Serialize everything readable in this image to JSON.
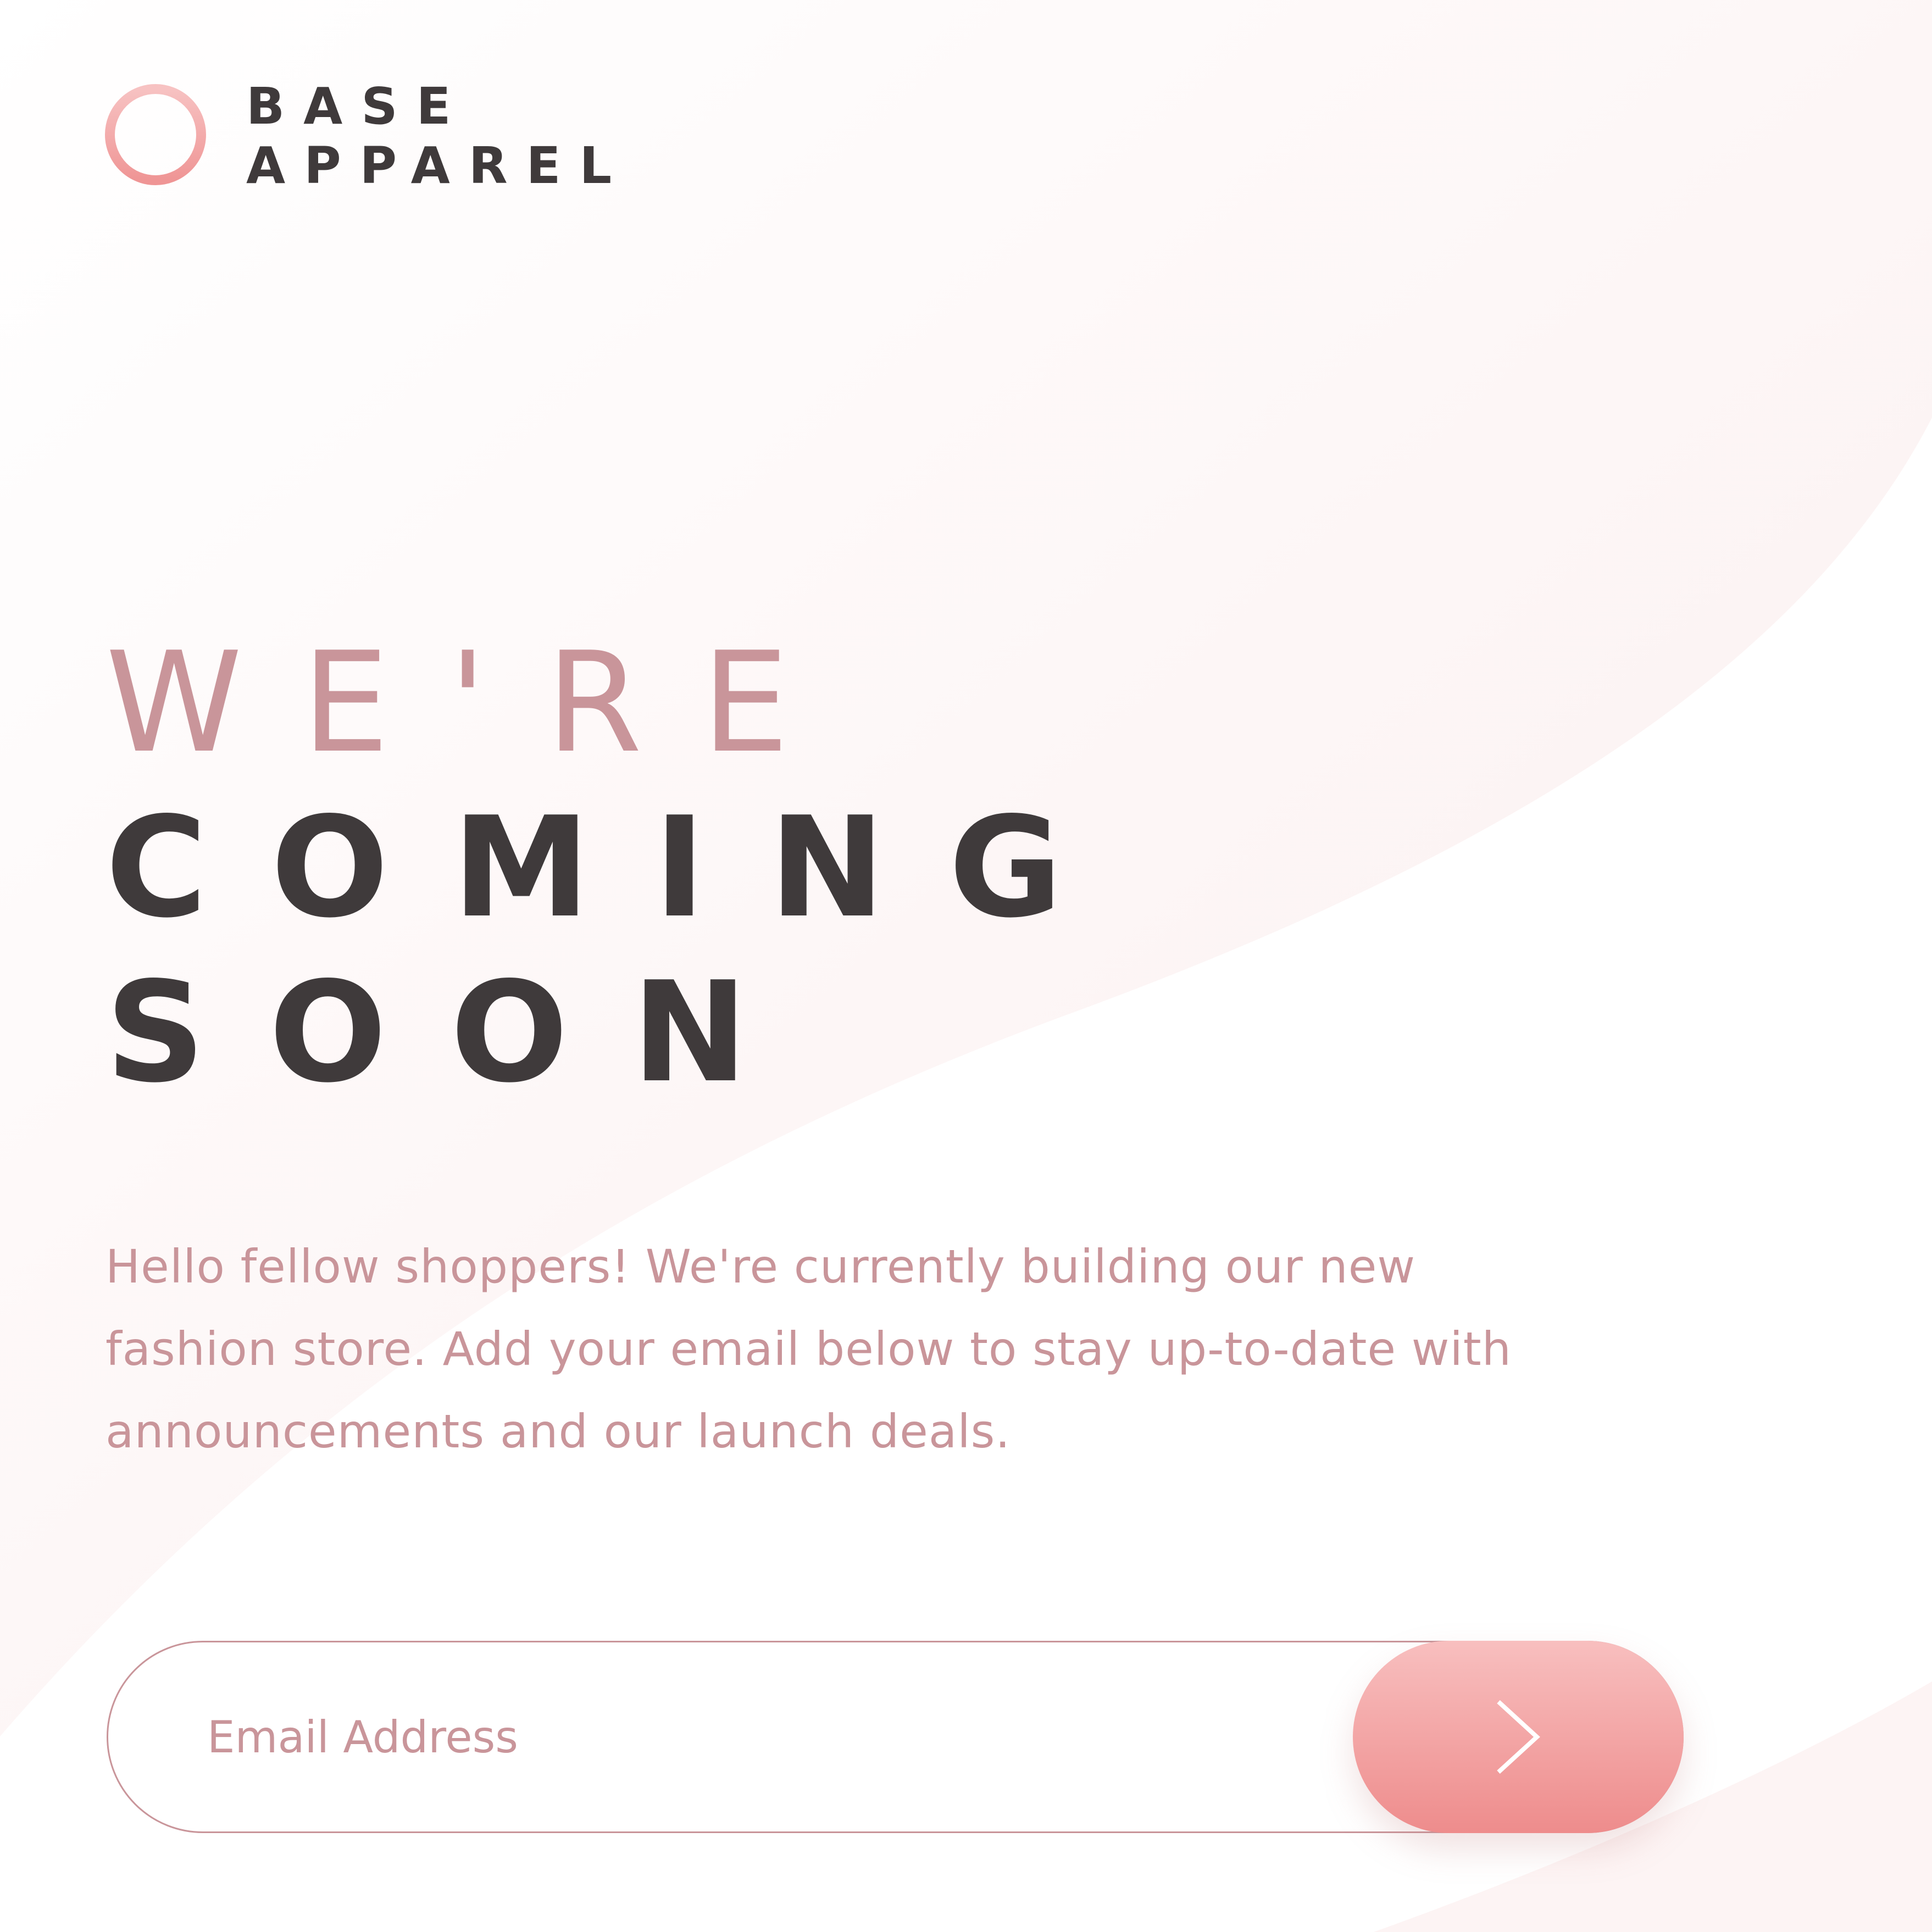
{
  "brand": {
    "name_line1": "BASE",
    "name_line2": "APPAREL"
  },
  "headline": {
    "line1": "WE'RE",
    "line2": "COMING",
    "line3": "SOON"
  },
  "intro_text": "Hello fellow shoppers! We're currently building our new fashion store. Add your email below to stay up-to-date with announcements and our launch deals.",
  "signup": {
    "email_placeholder": "Email Address",
    "submit_icon": "chevron-right-icon"
  },
  "colors": {
    "accent_pink": "#c9959a",
    "dark_text": "#3f3a3b",
    "button_gradient_top": "#f8bfbf",
    "button_gradient_bottom": "#ee8c8c",
    "background_tint": "#fdf5f5"
  }
}
